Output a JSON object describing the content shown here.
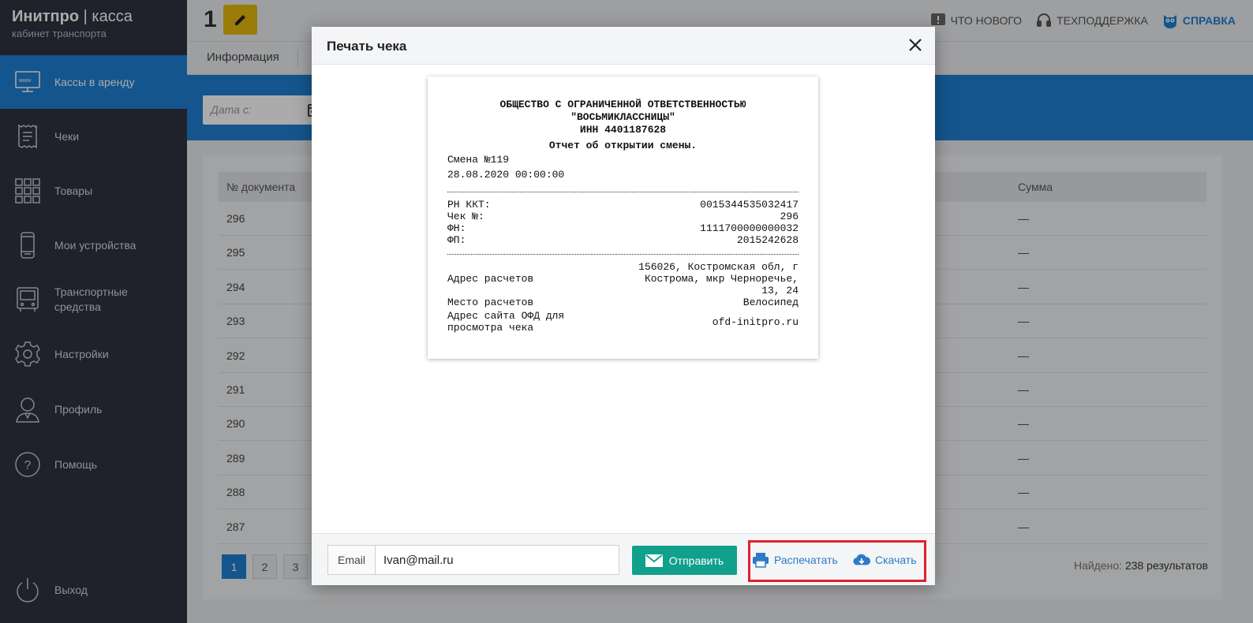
{
  "brand": {
    "name": "Инитпро",
    "product": "касса",
    "subtitle": "кабинет транспорта"
  },
  "sidebar": {
    "items": [
      {
        "label": "Кассы в аренду",
        "icon": "monitor-www-icon",
        "active": true
      },
      {
        "label": "Чеки",
        "icon": "receipt-icon"
      },
      {
        "label": "Товары",
        "icon": "grid-icon"
      },
      {
        "label": "Мои устройства",
        "icon": "phone-icon"
      },
      {
        "label": "Транспортные средства",
        "icon": "bus-icon"
      },
      {
        "label": "Настройки",
        "icon": "gear-icon"
      },
      {
        "label": "Профиль",
        "icon": "user-icon"
      },
      {
        "label": "Помощь",
        "icon": "help-icon"
      }
    ],
    "logout": "Выход"
  },
  "header": {
    "number": "1",
    "links": {
      "news": "Что нового",
      "support": "Техподдержка",
      "help": "Справка"
    }
  },
  "tabs": {
    "info": "Информация"
  },
  "filter": {
    "date_placeholder": "Дата с:"
  },
  "table": {
    "columns": {
      "doc": "№ документа",
      "sum": "Сумма"
    },
    "rows": [
      {
        "doc": "296",
        "sum": "—"
      },
      {
        "doc": "295",
        "sum": "—"
      },
      {
        "doc": "294",
        "sum": "—"
      },
      {
        "doc": "293",
        "sum": "—"
      },
      {
        "doc": "292",
        "sum": "—"
      },
      {
        "doc": "291",
        "sum": "—"
      },
      {
        "doc": "290",
        "sum": "—"
      },
      {
        "doc": "289",
        "sum": "—"
      },
      {
        "doc": "288",
        "sum": "—"
      },
      {
        "doc": "287",
        "sum": "—"
      }
    ],
    "pages": [
      "1",
      "2",
      "3"
    ],
    "found_label": "Найдено:",
    "found_value": "238 результатов"
  },
  "modal": {
    "title": "Печать чека",
    "receipt": {
      "org_line1": "ОБЩЕСТВО С ОГРАНИЧЕННОЙ ОТВЕТСТВЕННОСТЬЮ",
      "org_line2": "\"ВОСЬМИКЛАССНИЦЫ\"",
      "inn": "ИНН 4401187628",
      "doc_title": "Отчет об открытии смены.",
      "shift": "Смена №119",
      "datetime": "28.08.2020 00:00:00",
      "fields": [
        {
          "key": "РН ККТ:",
          "value": "0015344535032417"
        },
        {
          "key": "Чек №:",
          "value": "296"
        },
        {
          "key": "ФН:",
          "value": "1111700000000032"
        },
        {
          "key": "ФП:",
          "value": "2015242628"
        }
      ],
      "address_label": "Адрес расчетов",
      "address_value": "156026, Костромская обл, г Кострома, мкр Черноречье, 13, 24",
      "place_label": "Место расчетов",
      "place_value": "Велосипед",
      "site_label": "Адрес сайта ОФД для просмотра чека",
      "site_value": "ofd-initpro.ru"
    },
    "email_label": "Email",
    "email_value": "Ivan@mail.ru",
    "send_label": "Отправить",
    "print_label": "Распечатать",
    "download_label": "Скачать"
  },
  "colors": {
    "accent": "#1f7fd3",
    "sidebar": "#2f3240",
    "send": "#10a08b",
    "highlight": "#e0202a",
    "edit": "#e5b90f"
  }
}
